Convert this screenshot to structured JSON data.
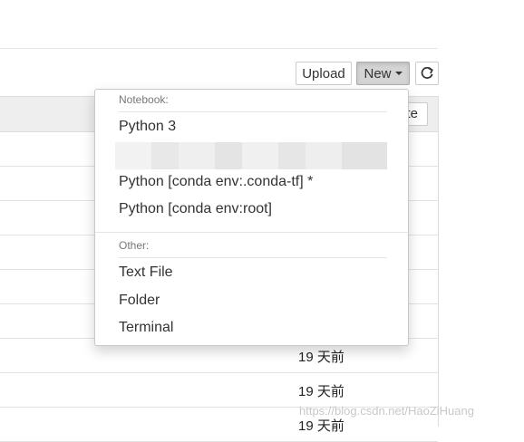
{
  "toolbar": {
    "upload_label": "Upload",
    "new_label": "New",
    "refresh_icon": "refresh-icon",
    "refresh_glyph": "⟳"
  },
  "list": {
    "hidden_button_label": "te",
    "dates": [
      "19 天前",
      "19 天前",
      "19 天前"
    ]
  },
  "new_menu": {
    "notebook_header": "Notebook:",
    "notebook_items": [
      "Python 3",
      "Python [conda env:.conda-tf] *",
      "Python [conda env:root]"
    ],
    "other_header": "Other:",
    "other_items": [
      "Text File",
      "Folder",
      "Terminal"
    ]
  },
  "watermark": "https://blog.csdn.net/HaoZiHuang"
}
